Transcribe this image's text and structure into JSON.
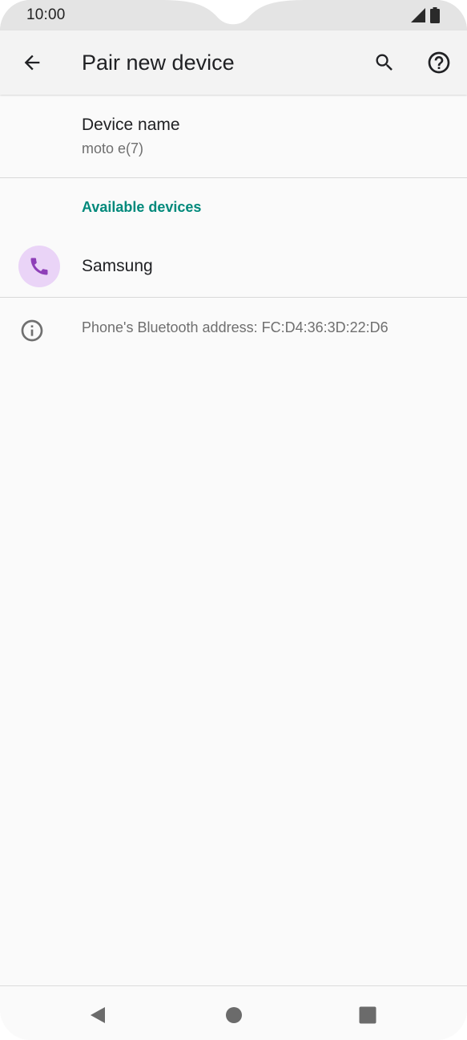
{
  "status_bar": {
    "time": "10:00",
    "icons": [
      "signal-icon",
      "battery-icon"
    ]
  },
  "app_bar": {
    "title": "Pair new device",
    "back_icon": "arrow-back-icon",
    "search_icon": "search-icon",
    "help_icon": "help-icon"
  },
  "device_name": {
    "title": "Device name",
    "value": "moto e(7)"
  },
  "available_devices": {
    "header": "Available devices",
    "items": [
      {
        "label": "Samsung",
        "icon": "phone-icon"
      }
    ]
  },
  "info": {
    "icon": "info-icon",
    "text": "Phone's Bluetooth address: FC:D4:36:3D:22:D6"
  },
  "nav_bar": {
    "buttons": [
      "nav-back-icon",
      "nav-home-icon",
      "nav-recents-icon"
    ]
  },
  "colors": {
    "accent": "#00897b",
    "device_icon_bg": "#ead4f7",
    "device_icon_fg": "#8e3fb8",
    "status_bar_bg": "#e4e4e4",
    "app_bar_bg": "#f3f3f3",
    "background": "#fafafa"
  }
}
